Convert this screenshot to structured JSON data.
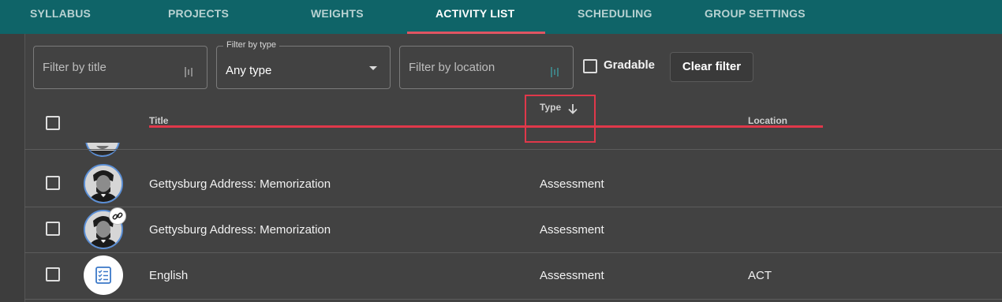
{
  "tabs": [
    {
      "label": "SYLLABUS",
      "active": false
    },
    {
      "label": "PROJECTS",
      "active": false
    },
    {
      "label": "WEIGHTS",
      "active": false
    },
    {
      "label": "ACTIVITY LIST",
      "active": true
    },
    {
      "label": "SCHEDULING",
      "active": false
    },
    {
      "label": "GROUP SETTINGS",
      "active": false
    }
  ],
  "filters": {
    "title": {
      "placeholder": "Filter by title",
      "icon": "mic-icon"
    },
    "type": {
      "label": "Filter by type",
      "value": "Any type",
      "icon": "chevron-down-icon"
    },
    "location": {
      "placeholder": "Filter by location",
      "icon": "mic-icon"
    },
    "gradable": {
      "label": "Gradable",
      "checked": false
    },
    "clear_label": "Clear filter"
  },
  "table": {
    "columns": {
      "title": "Title",
      "type": "Type",
      "location": "Location"
    },
    "sort": {
      "column": "Type",
      "direction": "descending",
      "icon": "arrow-down-icon"
    },
    "rows": [
      {
        "title": "Gettysburg Address: Memorization",
        "type": "Assessment",
        "location": "",
        "icon": "lincoln-portrait"
      },
      {
        "title": "Gettysburg Address: Memorization",
        "type": "Assessment",
        "location": "",
        "icon": "lincoln-portrait",
        "badge": "link-icon"
      },
      {
        "title": "English",
        "type": "Assessment",
        "location": "ACT",
        "icon": "checklist-icon"
      }
    ]
  },
  "colors": {
    "header_bg": "#0f6468",
    "page_bg": "#424242",
    "active_tab_underline": "#e05562",
    "annotation": "#e0384a",
    "avatar_border": "#5b8fd6",
    "checklist_icon": "#3b78c8"
  }
}
